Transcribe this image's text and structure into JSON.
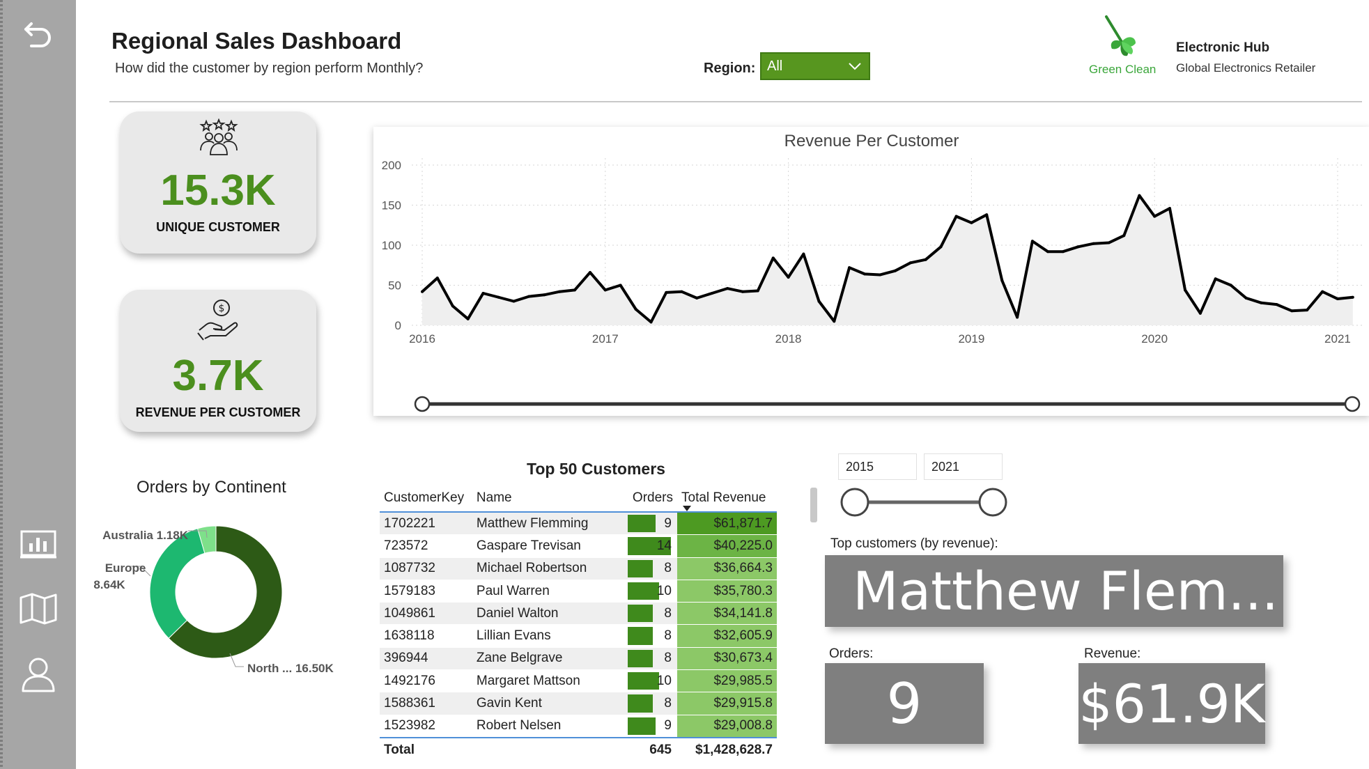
{
  "header": {
    "title": "Regional Sales Dashboard",
    "subtitle": "How did the customer by region perform Monthly?",
    "region_label": "Region:",
    "region_value": "All",
    "logo_text": "Green Clean",
    "company": "Electronic Hub",
    "tagline": "Global Electronics Retailer"
  },
  "kpis": {
    "unique_customers": {
      "value": "15.3K",
      "label": "UNIQUE CUSTOMER"
    },
    "revenue_per_customer": {
      "value": "3.7K",
      "label": "REVENUE PER CUSTOMER"
    }
  },
  "chart_data": [
    {
      "type": "area",
      "title": "Revenue Per Customer",
      "x_ticks": [
        "2016",
        "2017",
        "2018",
        "2019",
        "2020",
        "2021"
      ],
      "y_ticks": [
        0,
        50,
        100,
        150,
        200
      ],
      "ylim": [
        0,
        200
      ],
      "xlim": [
        2016.0,
        2021.08
      ],
      "grid": true,
      "line_color": "#000000",
      "fill_color": "#efefef",
      "x": [
        2016.0,
        2016.083,
        2016.167,
        2016.25,
        2016.333,
        2016.417,
        2016.5,
        2016.583,
        2016.667,
        2016.75,
        2016.833,
        2016.917,
        2017.0,
        2017.083,
        2017.167,
        2017.25,
        2017.333,
        2017.417,
        2017.5,
        2017.583,
        2017.667,
        2017.75,
        2017.833,
        2017.917,
        2018.0,
        2018.083,
        2018.167,
        2018.25,
        2018.333,
        2018.417,
        2018.5,
        2018.583,
        2018.667,
        2018.75,
        2018.833,
        2018.917,
        2019.0,
        2019.083,
        2019.167,
        2019.25,
        2019.333,
        2019.417,
        2019.5,
        2019.583,
        2019.667,
        2019.75,
        2019.833,
        2019.917,
        2020.0,
        2020.083,
        2020.167,
        2020.25,
        2020.333,
        2020.417,
        2020.5,
        2020.583,
        2020.667,
        2020.75,
        2020.833,
        2020.917,
        2021.0,
        2021.083
      ],
      "values": [
        42,
        59,
        24,
        8,
        40,
        35,
        30,
        36,
        38,
        42,
        44,
        66,
        44,
        50,
        20,
        4,
        41,
        42,
        34,
        40,
        46,
        42,
        43,
        84,
        60,
        89,
        30,
        5,
        72,
        64,
        63,
        68,
        78,
        82,
        98,
        136,
        128,
        138,
        56,
        10,
        105,
        92,
        92,
        98,
        102,
        103,
        112,
        162,
        136,
        146,
        44,
        15,
        58,
        50,
        34,
        28,
        26,
        18,
        19,
        42,
        33,
        35
      ]
    },
    {
      "type": "pie",
      "title": "Orders by Continent",
      "categories": [
        "North ...",
        "Europe",
        "Australia"
      ],
      "values": [
        16.5,
        8.64,
        1.18
      ],
      "value_labels": [
        "16.50K",
        "8.64K",
        "1.18K"
      ],
      "colors": [
        "#2d5a16",
        "#1db870",
        "#7ee08a"
      ]
    }
  ],
  "table": {
    "title": "Top 50 Customers",
    "columns": [
      "CustomerKey",
      "Name",
      "Orders",
      "Total Revenue"
    ],
    "rows": [
      [
        "1702221",
        "Matthew Flemming",
        "9",
        "$61,871.7"
      ],
      [
        "723572",
        "Gaspare Trevisan",
        "14",
        "$40,225.0"
      ],
      [
        "1087732",
        "Michael Robertson",
        "8",
        "$36,664.3"
      ],
      [
        "1579183",
        "Paul Warren",
        "10",
        "$35,780.3"
      ],
      [
        "1049861",
        "Daniel Walton",
        "8",
        "$34,141.8"
      ],
      [
        "1638118",
        "Lillian Evans",
        "8",
        "$32,605.9"
      ],
      [
        "396944",
        "Zane Belgrave",
        "8",
        "$30,673.4"
      ],
      [
        "1492176",
        "Margaret Mattson",
        "10",
        "$29,985.5"
      ],
      [
        "1588361",
        "Gavin Kent",
        "8",
        "$29,915.8"
      ],
      [
        "1523982",
        "Robert Nelsen",
        "9",
        "$29,008.8"
      ]
    ],
    "orders_max": 14,
    "total_label": "Total",
    "total_orders": "645",
    "total_revenue": "$1,428,628.7"
  },
  "year_range": {
    "start": "2015",
    "end": "2021"
  },
  "detail": {
    "top_label": "Top customers (by revenue):",
    "top_name": "Matthew Flem...",
    "orders_label": "Orders:",
    "orders_value": "9",
    "revenue_label": "Revenue:",
    "revenue_value": "$61.9K"
  },
  "colors": {
    "accent_green": "#4b8f1e",
    "dropdown_green": "#57961f",
    "card_grey": "#7f7f7f",
    "rail_grey": "#a6a6a6"
  },
  "icons": [
    "back-arrow-icon",
    "bar-chart-icon",
    "map-icon",
    "person-icon",
    "customers-stars-icon",
    "hand-coin-icon",
    "chevron-down-icon",
    "leaf-logo-icon"
  ]
}
